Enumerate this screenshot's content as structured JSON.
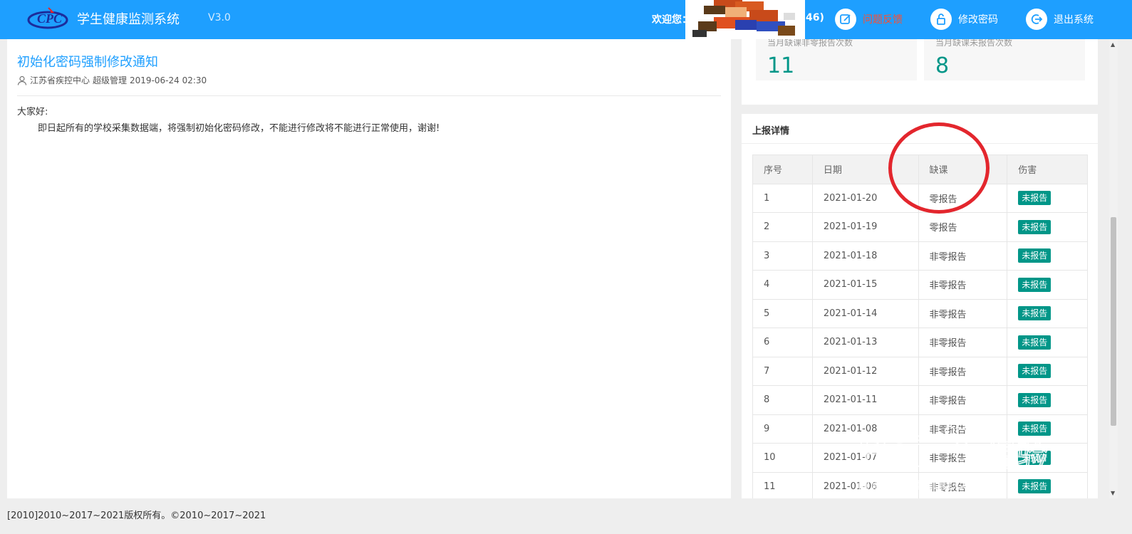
{
  "header": {
    "app_title": "学生健康监测系统",
    "version": "V3.0",
    "welcome": "欢迎您：",
    "user_suffix": "46)",
    "feedback_label": "问题反馈",
    "change_password_label": "修改密码",
    "logout_label": "退出系统",
    "colors": {
      "bar": "#1e9fff",
      "feedback": "#ff4d2e"
    }
  },
  "notice": {
    "title": "初始化密码强制修改通知",
    "author": "江苏省疾控中心",
    "role": "超级管理",
    "datetime": "2019-06-24 02:30",
    "greeting": "大家好:",
    "body": "即日起所有的学校采集数据端，将强制初始化密码修改，不能进行修改将不能进行正常使用，谢谢!"
  },
  "stats": [
    {
      "label": "当月缺课非零报告次数",
      "value": "11"
    },
    {
      "label": "当月缺课未报告次数",
      "value": "8"
    }
  ],
  "report": {
    "title": "上报详情",
    "columns": [
      "序号",
      "日期",
      "缺课",
      "伤害"
    ],
    "rows": [
      {
        "no": "1",
        "date": "2021-01-20",
        "absence": "零报告",
        "injury": "未报告"
      },
      {
        "no": "2",
        "date": "2021-01-19",
        "absence": "零报告",
        "injury": "未报告"
      },
      {
        "no": "3",
        "date": "2021-01-18",
        "absence": "非零报告",
        "injury": "未报告"
      },
      {
        "no": "4",
        "date": "2021-01-15",
        "absence": "非零报告",
        "injury": "未报告"
      },
      {
        "no": "5",
        "date": "2021-01-14",
        "absence": "非零报告",
        "injury": "未报告"
      },
      {
        "no": "6",
        "date": "2021-01-13",
        "absence": "非零报告",
        "injury": "未报告"
      },
      {
        "no": "7",
        "date": "2021-01-12",
        "absence": "非零报告",
        "injury": "未报告"
      },
      {
        "no": "8",
        "date": "2021-01-11",
        "absence": "非零报告",
        "injury": "未报告"
      },
      {
        "no": "9",
        "date": "2021-01-08",
        "absence": "非零报告",
        "injury": "未报告"
      },
      {
        "no": "10",
        "date": "2021-01-07",
        "absence": "非零报告",
        "injury": "未报告"
      },
      {
        "no": "11",
        "date": "2021-01-06",
        "absence": "非零报告",
        "injury": "未报告"
      }
    ],
    "badge_color": "#009688"
  },
  "footer": {
    "copyright": "[2010]2010~2017~2021版权所有。©2010~2017~2021"
  },
  "watermark": {
    "brand": "Bai",
    "brand_cn": "经验",
    "url": "jingyan.baidu.com"
  },
  "icons": [
    "logo-icon",
    "feedback-icon",
    "lock-icon",
    "logout-icon",
    "user-icon"
  ]
}
